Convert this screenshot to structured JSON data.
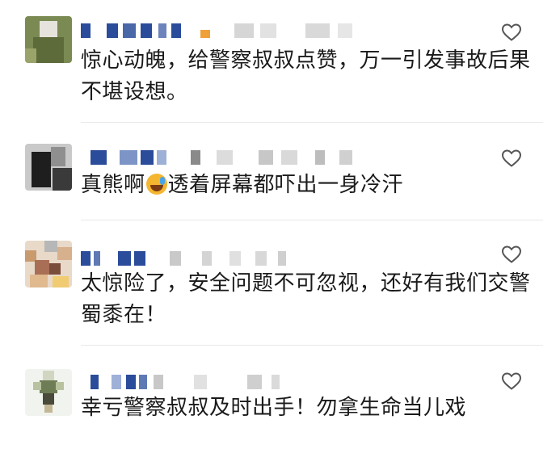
{
  "comments": [
    {
      "name_redacted": true,
      "text": "惊心动魄，给警察叔叔点赞，万一引发事故后果不堪设想。",
      "like_icon": "heart-outline-icon"
    },
    {
      "name_redacted": true,
      "text_before_emoji": "真熊啊",
      "emoji": "crying-laughing-emoji",
      "text_after_emoji": "透着屏幕都吓出一身冷汗",
      "like_icon": "heart-outline-icon"
    },
    {
      "name_redacted": true,
      "text": "太惊险了，安全问题不可忽视，还好有我们交警蜀黍在！",
      "like_icon": "heart-outline-icon"
    },
    {
      "name_redacted": true,
      "text": "幸亏警察叔叔及时出手！勿拿生命当儿戏",
      "like_icon": "heart-outline-icon"
    }
  ],
  "colors": {
    "text": "#1a1a1a",
    "divider": "#e9e9e9",
    "heart_outline": "#555555",
    "redaction_blue": "#2b4c9a",
    "redaction_grey": "#cfcfcf"
  }
}
